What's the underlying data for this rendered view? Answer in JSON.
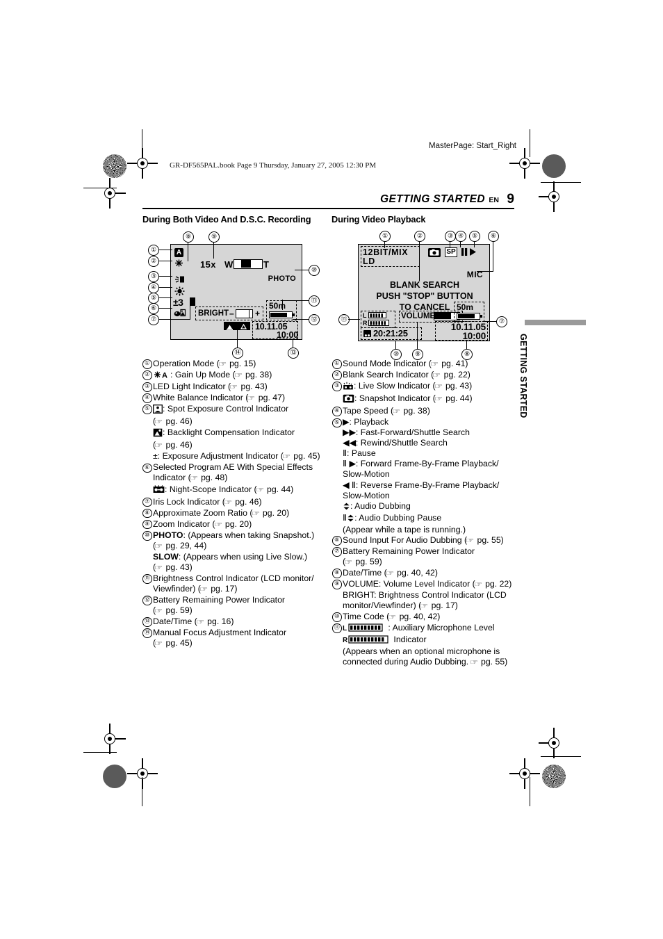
{
  "page": {
    "masterpage": "MasterPage: Start_Right",
    "bookline": "GR-DF565PAL.book  Page 9  Thursday, January 27, 2005  12:30 PM",
    "running_head": "GETTING STARTED",
    "en_label": "EN",
    "page_number": "9",
    "side_tab": "GETTING STARTED"
  },
  "left_column": {
    "heading": "During Both Video And D.S.C. Recording",
    "lcd": {
      "zoom_ratio": "15x",
      "zoom_w": "W",
      "zoom_t": "T",
      "exposure": "±3",
      "photo": "PHOTO",
      "bright_label": "BRIGHT",
      "bright_minus": "–",
      "bright_plus": "+",
      "tape_remaining": "50m",
      "date": "10.11.05",
      "time": "10:00"
    },
    "legend": [
      {
        "num": "①",
        "lines": [
          "Operation Mode (☞ pg. 15)"
        ]
      },
      {
        "num": "②",
        "lines": [
          "ICON_GAINUP: Gain Up Mode (☞ pg. 38)"
        ]
      },
      {
        "num": "③",
        "lines": [
          "LED Light Indicator (☞ pg. 43)"
        ]
      },
      {
        "num": "④",
        "lines": [
          "White Balance Indicator (☞ pg. 47)"
        ]
      },
      {
        "num": "⑤",
        "lines": [
          "ICON_SPOT: Spot Exposure Control Indicator",
          "(☞ pg. 46)",
          "ICON_BACKLIGHT: Backlight Compensation Indicator",
          "(☞ pg. 46)",
          "±: Exposure Adjustment Indicator (☞ pg. 45)"
        ]
      },
      {
        "num": "⑥",
        "lines": [
          "Selected Program AE With Special Effects",
          "Indicator (☞ pg. 48)",
          "ICON_NIGHTSCOPE: Night-Scope Indicator (☞ pg. 44)"
        ]
      },
      {
        "num": "⑦",
        "lines": [
          "Iris Lock Indicator (☞ pg. 46)"
        ]
      },
      {
        "num": "⑧",
        "lines": [
          "Approximate Zoom Ratio (☞ pg. 20)"
        ]
      },
      {
        "num": "⑨",
        "lines": [
          "Zoom Indicator (☞ pg. 20)"
        ]
      },
      {
        "num": "⑩",
        "lines": [
          "BOLD_PHOTO: (Appears when taking Snapshot.)",
          "(☞ pg. 29, 44)",
          "BOLD_SLOW: (Appears when using Live Slow.)",
          "(☞ pg. 43)"
        ]
      },
      {
        "num": "⑪",
        "lines": [
          "Brightness Control Indicator (LCD monitor/",
          "Viewfinder) (☞ pg. 17)"
        ]
      },
      {
        "num": "⑫",
        "lines": [
          "Battery Remaining Power Indicator",
          "(☞ pg. 59)"
        ]
      },
      {
        "num": "⑬",
        "lines": [
          "Date/Time (☞ pg. 16)"
        ]
      },
      {
        "num": "⑭",
        "lines": [
          "Manual Focus Adjustment Indicator",
          "(☞ pg. 45)"
        ]
      }
    ]
  },
  "right_column": {
    "heading": "During Video Playback",
    "lcd": {
      "sound_mode": "12BIT/MIX",
      "sound_mode_sub": "LD",
      "tape_speed": "SP",
      "mic": "MIC",
      "message_line1": "BLANK  SEARCH",
      "message_line2": "PUSH \"STOP\" BUTTON",
      "message_line3": "TO  CANCEL",
      "level_l": "L",
      "level_r": "R",
      "volume_label": "VOLUME",
      "time_code": "20:21:25",
      "tape_remaining": "50m",
      "date": "10.11.05",
      "time": "10:00"
    },
    "legend": [
      {
        "num": "①",
        "lines": [
          "Sound Mode Indicator (☞ pg. 41)"
        ]
      },
      {
        "num": "②",
        "lines": [
          "Blank Search Indicator (☞ pg. 22)"
        ]
      },
      {
        "num": "③",
        "lines": [
          "ICON_LIVESLOW: Live Slow Indicator (☞ pg. 43)",
          "ICON_SNAPSHOT: Snapshot Indicator (☞ pg. 44)"
        ]
      },
      {
        "num": "④",
        "lines": [
          "Tape Speed (☞ pg. 38)"
        ]
      },
      {
        "num": "⑤",
        "lines": [
          "▶: Playback",
          "▶▶: Fast-Forward/Shuttle Search",
          "◀◀: Rewind/Shuttle Search",
          "Ⅱ: Pause",
          "Ⅱ ▶: Forward Frame-By-Frame Playback/",
          "Slow-Motion",
          "◀ Ⅱ: Reverse Frame-By-Frame Playback/",
          "Slow-Motion",
          "ICON_DUB: Audio Dubbing",
          "ⅡICON_DUB: Audio Dubbing Pause",
          "(Appear while a tape is running.)"
        ]
      },
      {
        "num": "⑥",
        "lines": [
          "Sound Input For Audio Dubbing (☞ pg. 55)"
        ]
      },
      {
        "num": "⑦",
        "lines": [
          "Battery Remaining Power Indicator",
          "(☞ pg. 59)"
        ]
      },
      {
        "num": "⑧",
        "lines": [
          "Date/Time (☞ pg. 40, 42)"
        ]
      },
      {
        "num": "⑨",
        "lines": [
          "VOLUME: Volume Level Indicator (☞ pg. 22)",
          "BRIGHT: Brightness Control Indicator (LCD",
          "monitor/Viewfinder) (☞ pg. 17)"
        ]
      },
      {
        "num": "⑩",
        "lines": [
          "Time Code (☞ pg. 40, 42)"
        ]
      },
      {
        "num": "⑪",
        "lines": [
          "METER_L : Auxiliary Microphone Level",
          "METER_R  Indicator",
          "(Appears when an optional microphone is",
          "connected during Audio Dubbing. ☞ pg. 55)"
        ]
      }
    ]
  },
  "callouts": {
    "left": [
      "①",
      "②",
      "③",
      "④",
      "⑤",
      "⑥",
      "⑦",
      "⑧",
      "⑨",
      "⑩",
      "⑪",
      "⑫",
      "⑬",
      "⑭"
    ],
    "right": [
      "①",
      "②",
      "③",
      "④",
      "⑤",
      "⑥",
      "⑦",
      "⑧",
      "⑨",
      "⑩",
      "⑪"
    ]
  },
  "colors": {
    "lcd_background": "#d6d6d6",
    "side_tab_bar": "#9a9a9a",
    "ink": "#000000"
  }
}
